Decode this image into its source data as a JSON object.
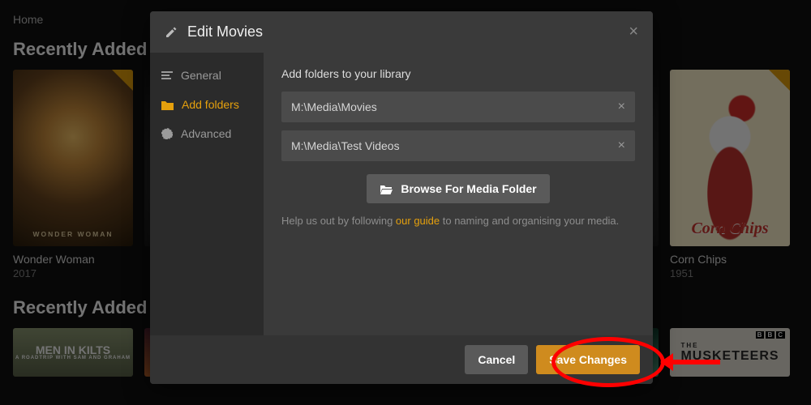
{
  "nav": {
    "home": "Home"
  },
  "sections": {
    "movies_heading": "Recently Added in Movies",
    "tv_heading": "Recently Added in TV"
  },
  "cards": {
    "wonder_woman": {
      "title": "Wonder Woman",
      "year": "2017"
    },
    "corn_chips": {
      "title": "Corn Chips",
      "year": "1951",
      "poster_title": "Corn Chips"
    }
  },
  "tv_tiles": {
    "kilts_line1": "MEN IN KILTS",
    "kilts_line2": "A ROADTRIP WITH SAM AND GRAHAM",
    "musketeers": "MUSKETEERS",
    "musketeers_prefix": "THE",
    "bbc": [
      "B",
      "B",
      "C"
    ]
  },
  "modal": {
    "title": "Edit Movies",
    "tabs": {
      "general": "General",
      "add_folders": "Add folders",
      "advanced": "Advanced"
    },
    "lead": "Add folders to your library",
    "folders": [
      "M:\\Media\\Movies",
      "M:\\Media\\Test Videos"
    ],
    "browse": "Browse For Media Folder",
    "help_pre": "Help us out by following ",
    "help_link": "our guide",
    "help_post": " to naming and organising your media.",
    "cancel": "Cancel",
    "save": "Save Changes"
  }
}
